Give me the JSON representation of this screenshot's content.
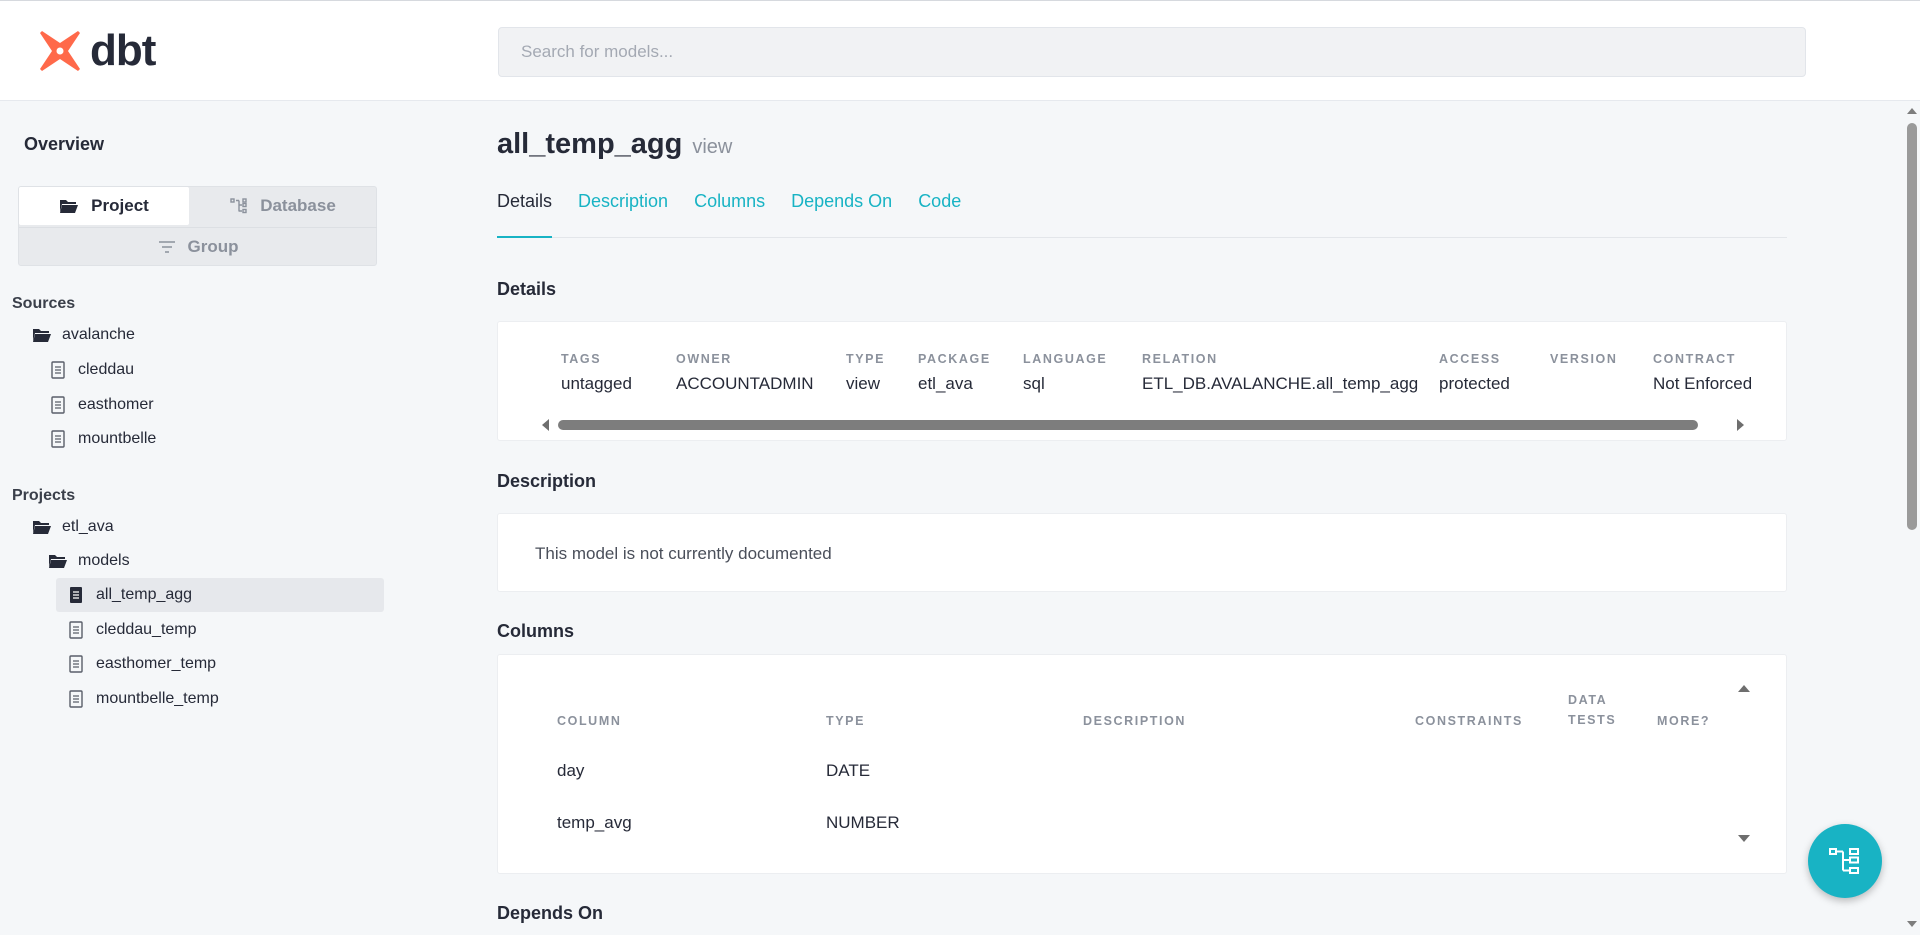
{
  "app": {
    "logo_text": "dbt",
    "accent_color": "#18b3c4",
    "logo_color": "#ff694a"
  },
  "search": {
    "placeholder": "Search for models..."
  },
  "sidebar": {
    "overview_label": "Overview",
    "switcher": {
      "project": "Project",
      "database": "Database",
      "group": "Group",
      "active": "Project"
    },
    "sources_label": "Sources",
    "sources": [
      {
        "label": "avalanche",
        "icon": "folder-open-icon"
      },
      {
        "label": "cleddau",
        "icon": "file-icon"
      },
      {
        "label": "easthomer",
        "icon": "file-icon"
      },
      {
        "label": "mountbelle",
        "icon": "file-icon"
      }
    ],
    "projects_label": "Projects",
    "projects": [
      {
        "label": "etl_ava",
        "icon": "folder-open-icon"
      },
      {
        "label": "models",
        "icon": "folder-open-icon"
      },
      {
        "label": "all_temp_agg",
        "icon": "file-filled-icon",
        "active": true
      },
      {
        "label": "cleddau_temp",
        "icon": "file-icon"
      },
      {
        "label": "easthomer_temp",
        "icon": "file-icon"
      },
      {
        "label": "mountbelle_temp",
        "icon": "file-icon"
      }
    ]
  },
  "main": {
    "title": "all_temp_agg",
    "kind": "view",
    "tabs": [
      "Details",
      "Description",
      "Columns",
      "Depends On",
      "Code"
    ],
    "active_tab": "Details",
    "details_heading": "Details",
    "details": [
      {
        "label": "TAGS",
        "value": "untagged"
      },
      {
        "label": "OWNER",
        "value": "ACCOUNTADMIN"
      },
      {
        "label": "TYPE",
        "value": "view"
      },
      {
        "label": "PACKAGE",
        "value": "etl_ava"
      },
      {
        "label": "LANGUAGE",
        "value": "sql"
      },
      {
        "label": "RELATION",
        "value": "ETL_DB.AVALANCHE.all_temp_agg"
      },
      {
        "label": "ACCESS",
        "value": "protected"
      },
      {
        "label": "VERSION",
        "value": ""
      },
      {
        "label": "CONTRACT",
        "value": "Not Enforced"
      }
    ],
    "description_heading": "Description",
    "description_text": "This model is not currently documented",
    "columns_heading": "Columns",
    "columns_headers": [
      "COLUMN",
      "TYPE",
      "DESCRIPTION",
      "CONSTRAINTS",
      "DATA\nTESTS",
      "MORE?"
    ],
    "columns_rows": [
      {
        "column": "day",
        "type": "DATE"
      },
      {
        "column": "temp_avg",
        "type": "NUMBER"
      }
    ],
    "depends_heading": "Depends On"
  }
}
